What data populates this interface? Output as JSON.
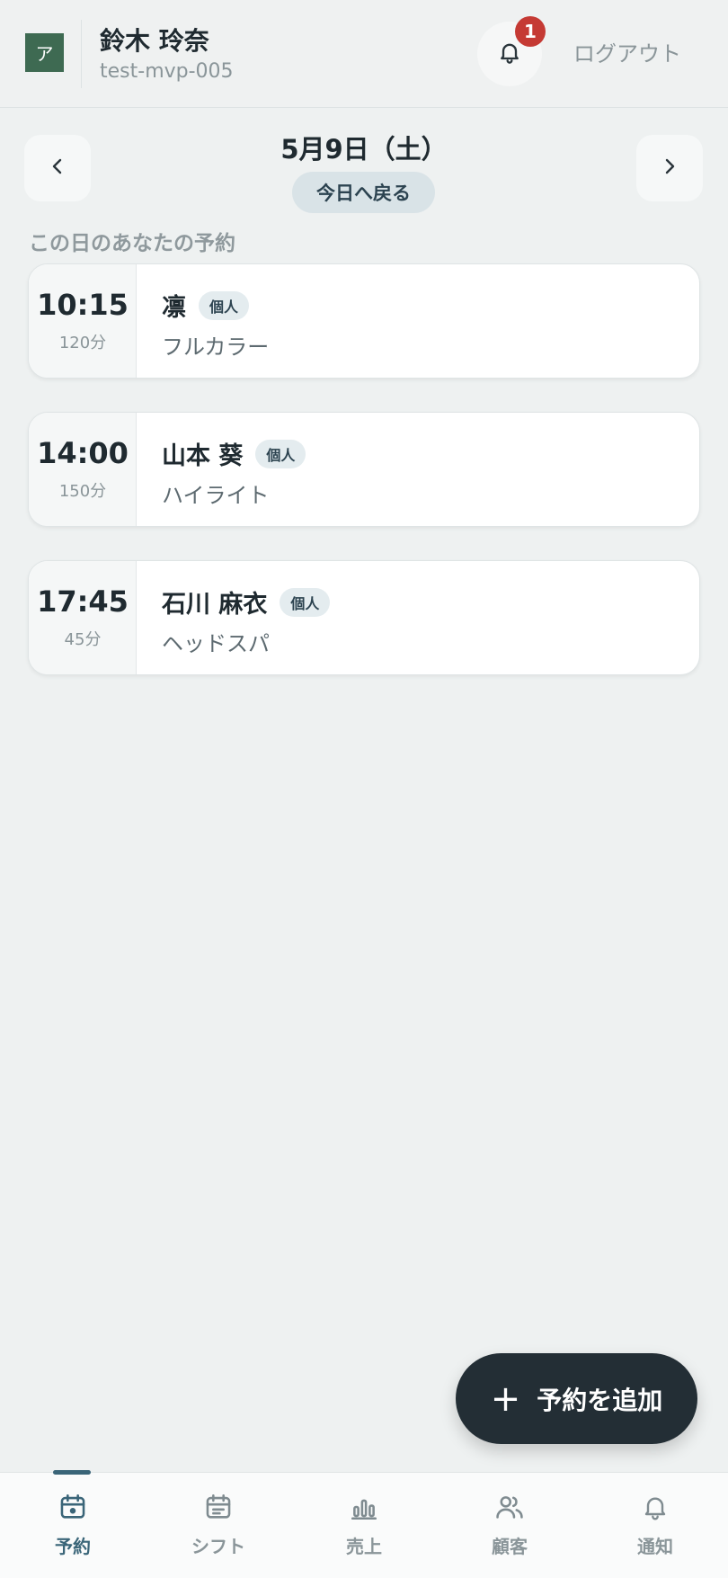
{
  "header": {
    "logo_text": "ア",
    "user_name": "鈴木 玲奈",
    "user_id": "test-mvp-005",
    "notification_count": "1",
    "logout_label": "ログアウト"
  },
  "date_nav": {
    "date": "5月9日（土）",
    "today_label": "今日へ戻る"
  },
  "section_label": "この日のあなたの予約",
  "reservations": [
    {
      "time": "10:15",
      "duration": "120分",
      "customer": "凛",
      "tag": "個人",
      "menu": "フルカラー"
    },
    {
      "time": "14:00",
      "duration": "150分",
      "customer": "山本 葵",
      "tag": "個人",
      "menu": "ハイライト"
    },
    {
      "time": "17:45",
      "duration": "45分",
      "customer": "石川 麻衣",
      "tag": "個人",
      "menu": "ヘッドスパ"
    }
  ],
  "fab": {
    "plus": "+",
    "label": "予約を追加"
  },
  "bottom_nav": [
    {
      "label": "予約",
      "icon": "calendar-icon",
      "active": true
    },
    {
      "label": "シフト",
      "icon": "schedule-icon",
      "active": false
    },
    {
      "label": "売上",
      "icon": "bar-chart-icon",
      "active": false
    },
    {
      "label": "顧客",
      "icon": "users-icon",
      "active": false
    },
    {
      "label": "通知",
      "icon": "bell-icon",
      "active": false
    }
  ],
  "colors": {
    "accent": "#3a6578",
    "badge": "#c53a34",
    "fab": "#232e35",
    "logo": "#3e6a52"
  }
}
